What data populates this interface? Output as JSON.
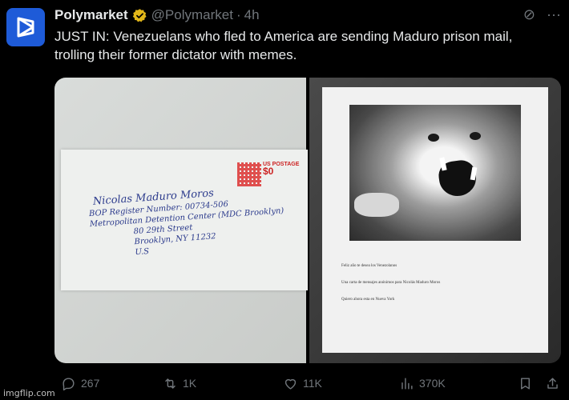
{
  "tweet": {
    "author_name": "Polymarket",
    "handle": "@Polymarket",
    "separator": "·",
    "time": "4h",
    "text_lines": [
      "JUST IN: Venezuelans who fled to America are sending Maduro prison mail,",
      "trolling their former dictator with memes."
    ]
  },
  "icons": {
    "avatar": "polymarket-logo",
    "verified": "verified-badge-icon",
    "grok": "grok-icon",
    "more": "more-icon"
  },
  "header_glyphs": {
    "grok": "⊘",
    "more": "···"
  },
  "envelope": {
    "postage_label": "US POSTAGE",
    "postage_amount": "$0",
    "address_lines": [
      "Nicolas Maduro Moros",
      "BOP Register Number: 00734-506",
      "Metropolitan Detention Center (MDC Brooklyn)",
      "80 29th Street",
      "Brooklyn, NY 11232",
      "U.S"
    ]
  },
  "letter": {
    "lines": [
      "Feliz año te desea los Venezolanos",
      "Una carta de mensajes anónimos para Nicolás Maduro Moros",
      "Quiero ahora esta en Nueva York"
    ]
  },
  "actions": {
    "replies": "267",
    "reposts": "1K",
    "likes": "11K",
    "views": "370K"
  },
  "watermark": "imgflip.com",
  "colors": {
    "background": "#000000",
    "text": "#e7e9ea",
    "muted": "#71767b",
    "verified": "#e2b719",
    "avatar": "#1e5bd8"
  }
}
